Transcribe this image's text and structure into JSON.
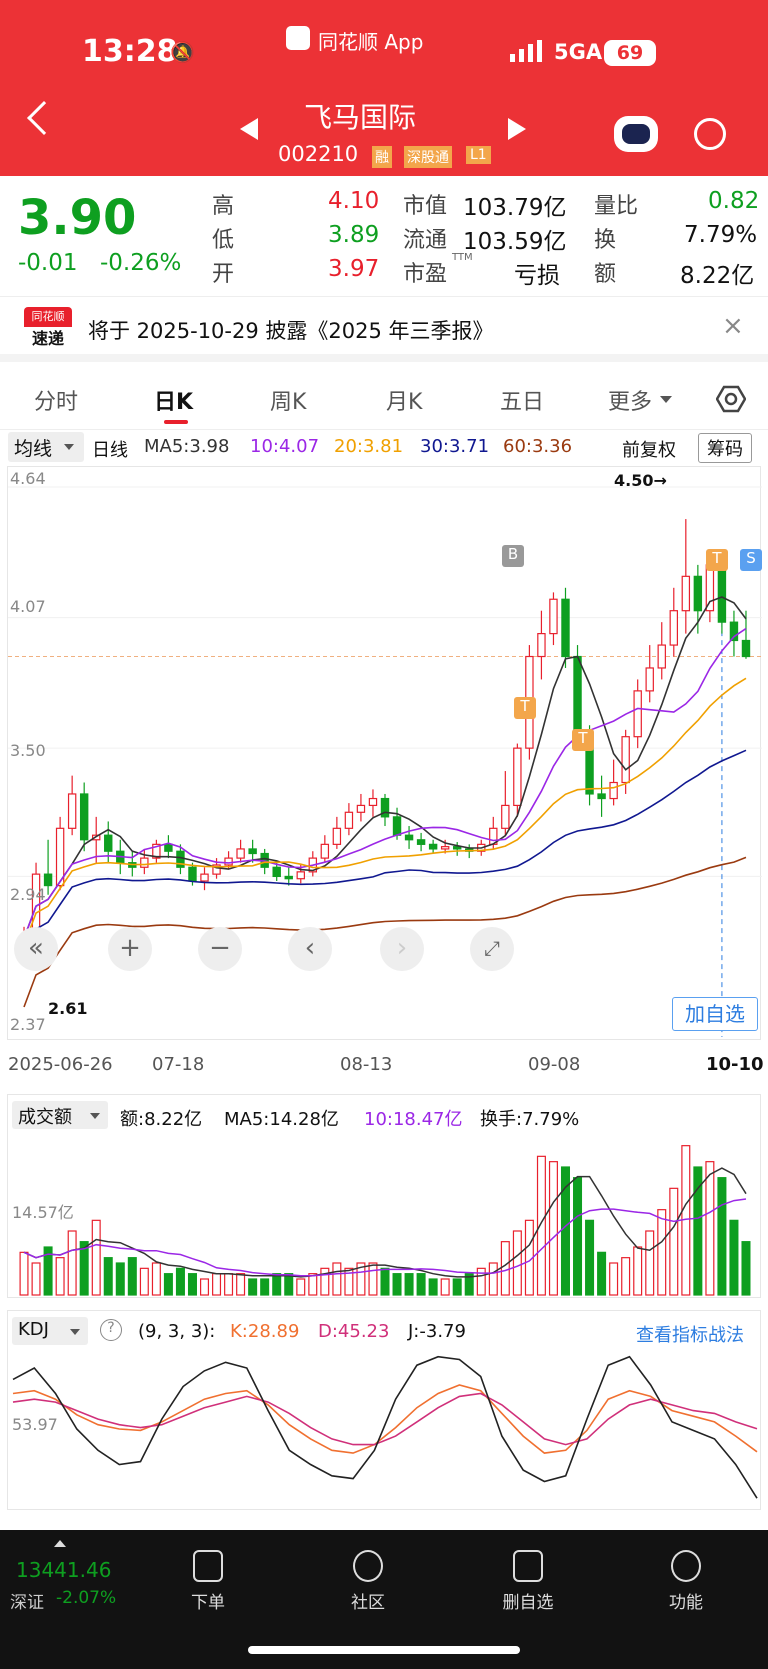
{
  "status_bar": {
    "time": "13:28",
    "app_name": "同花顺 App",
    "network": "5GA",
    "battery": "69"
  },
  "stock": {
    "name": "飞马国际",
    "code": "002210",
    "tags": [
      "融",
      "深股通",
      "L1"
    ]
  },
  "quote": {
    "price": "3.90",
    "change": "-0.01",
    "change_pct": "-0.26%",
    "high_label": "高",
    "high": "4.10",
    "low_label": "低",
    "low": "3.89",
    "open_label": "开",
    "open": "3.97",
    "mcap_label": "市值",
    "mcap": "103.79亿",
    "float_label": "流通",
    "float": "103.59亿",
    "pe_label": "市盈",
    "pe_sup": "TTM",
    "pe": "亏损",
    "vr_label": "量比",
    "vr": "0.82",
    "turn_label": "换",
    "turn": "7.79%",
    "amt_label": "额",
    "amt": "8.22亿"
  },
  "notice": {
    "logo_top": "同花顺",
    "logo_bottom": "速递",
    "text": "将于 2025-10-29 披露《2025 年三季报》"
  },
  "tabs": [
    "分时",
    "日K",
    "周K",
    "月K",
    "五日",
    "更多"
  ],
  "ma_line": {
    "selector": "均线",
    "period": "日线",
    "ma5": "MA5:3.98",
    "ma10": "10:4.07",
    "ma20": "20:3.81",
    "ma30": "30:3.71",
    "ma60": "60:3.36",
    "adjust": "前复权",
    "chips": "筹码"
  },
  "kline": {
    "y_labels": [
      "4.64",
      "4.07",
      "3.50",
      "2.94",
      "2.37"
    ],
    "max_marker": "4.50→",
    "min_marker": "2.61",
    "markers": [
      "B",
      "T",
      "T",
      "T",
      "S"
    ],
    "dates": [
      "2025-06-26",
      "07-18",
      "08-13",
      "09-08",
      "10-10"
    ],
    "add_watch": "加自选"
  },
  "volume": {
    "selector": "成交额",
    "amt": "额:8.22亿",
    "ma5": "MA5:14.28亿",
    "ma10": "10:18.47亿",
    "turnover": "换手:7.79%",
    "y_label": "14.57亿"
  },
  "kdj": {
    "selector": "KDJ",
    "params": "(9, 3, 3):",
    "k": "K:28.89",
    "d": "D:45.23",
    "j": "J:-3.79",
    "link": "查看指标战法",
    "y_label": "53.97"
  },
  "index_bar": {
    "value": "13441.46",
    "name": "深证",
    "change": "-2.07%"
  },
  "nav": [
    "下单",
    "社区",
    "删自选",
    "功能"
  ],
  "colors": {
    "header_bg": "#ec3236",
    "up": "#e8202c",
    "down": "#0e9f20",
    "ma10": "#9b27e6",
    "ma20": "#f0a000",
    "ma30": "#101890",
    "ma60": "#9a3a10"
  },
  "chart_data": [
    {
      "type": "candlestick",
      "title": "日K",
      "x_range": [
        "2025-06-26",
        "10-10"
      ],
      "ylim": [
        2.37,
        4.64
      ],
      "candles": [
        [
          2.61,
          2.67,
          2.58,
          2.72
        ],
        [
          2.67,
          2.95,
          2.65,
          3.0
        ],
        [
          2.95,
          2.9,
          2.86,
          3.1
        ],
        [
          2.9,
          3.15,
          2.88,
          3.2
        ],
        [
          3.15,
          3.3,
          3.12,
          3.38
        ],
        [
          3.3,
          3.1,
          3.05,
          3.35
        ],
        [
          3.1,
          3.12,
          3.0,
          3.2
        ],
        [
          3.12,
          3.05,
          3.0,
          3.18
        ],
        [
          3.05,
          3.0,
          2.95,
          3.1
        ],
        [
          3.0,
          2.98,
          2.94,
          3.05
        ],
        [
          2.98,
          3.02,
          2.95,
          3.06
        ],
        [
          3.02,
          3.08,
          3.0,
          3.1
        ],
        [
          3.08,
          3.05,
          3.02,
          3.12
        ],
        [
          3.05,
          2.98,
          2.95,
          3.08
        ],
        [
          2.98,
          2.92,
          2.9,
          3.0
        ],
        [
          2.92,
          2.95,
          2.88,
          2.98
        ],
        [
          2.95,
          2.99,
          2.93,
          3.02
        ],
        [
          2.99,
          3.02,
          2.97,
          3.05
        ],
        [
          3.02,
          3.06,
          3.0,
          3.1
        ],
        [
          3.06,
          3.04,
          3.0,
          3.1
        ],
        [
          3.04,
          2.98,
          2.95,
          3.06
        ],
        [
          2.98,
          2.94,
          2.92,
          3.0
        ],
        [
          2.94,
          2.93,
          2.9,
          2.98
        ],
        [
          2.93,
          2.96,
          2.91,
          2.99
        ],
        [
          2.96,
          3.02,
          2.94,
          3.05
        ],
        [
          3.02,
          3.08,
          3.0,
          3.12
        ],
        [
          3.08,
          3.15,
          3.06,
          3.2
        ],
        [
          3.15,
          3.22,
          3.12,
          3.26
        ],
        [
          3.22,
          3.25,
          3.18,
          3.3
        ],
        [
          3.25,
          3.28,
          3.2,
          3.32
        ],
        [
          3.28,
          3.2,
          3.16,
          3.3
        ],
        [
          3.2,
          3.12,
          3.1,
          3.24
        ],
        [
          3.12,
          3.1,
          3.06,
          3.16
        ],
        [
          3.1,
          3.08,
          3.05,
          3.13
        ],
        [
          3.08,
          3.06,
          3.04,
          3.1
        ],
        [
          3.06,
          3.07,
          3.04,
          3.1
        ],
        [
          3.07,
          3.06,
          3.03,
          3.09
        ],
        [
          3.06,
          3.05,
          3.02,
          3.08
        ],
        [
          3.05,
          3.08,
          3.03,
          3.1
        ],
        [
          3.08,
          3.15,
          3.06,
          3.2
        ],
        [
          3.15,
          3.25,
          3.12,
          3.4
        ],
        [
          3.25,
          3.5,
          3.2,
          3.52
        ],
        [
          3.5,
          3.9,
          3.45,
          3.95
        ],
        [
          3.9,
          4.0,
          3.8,
          4.1
        ],
        [
          4.0,
          4.15,
          3.95,
          4.18
        ],
        [
          4.15,
          3.9,
          3.85,
          4.2
        ],
        [
          3.9,
          3.55,
          3.5,
          3.95
        ],
        [
          3.55,
          3.3,
          3.25,
          3.6
        ],
        [
          3.3,
          3.28,
          3.2,
          3.38
        ],
        [
          3.28,
          3.35,
          3.25,
          3.45
        ],
        [
          3.35,
          3.55,
          3.3,
          3.58
        ],
        [
          3.55,
          3.75,
          3.5,
          3.8
        ],
        [
          3.75,
          3.85,
          3.7,
          3.95
        ],
        [
          3.85,
          3.95,
          3.8,
          4.05
        ],
        [
          3.95,
          4.1,
          3.9,
          4.2
        ],
        [
          4.1,
          4.25,
          4.0,
          4.5
        ],
        [
          4.25,
          4.1,
          4.0,
          4.3
        ],
        [
          4.1,
          4.3,
          4.05,
          4.35
        ],
        [
          4.3,
          4.05,
          4.0,
          4.35
        ],
        [
          4.05,
          3.97,
          3.9,
          4.1
        ],
        [
          3.97,
          3.9,
          3.89,
          4.1
        ]
      ]
    },
    {
      "type": "bar",
      "title": "成交额",
      "ylim": [
        0,
        30
      ],
      "values": [
        8,
        6,
        9,
        7,
        12,
        10,
        14,
        7,
        6,
        7,
        5,
        6,
        4,
        5,
        4,
        3,
        4,
        4,
        4,
        3,
        3,
        4,
        4,
        3,
        4,
        5,
        6,
        5,
        6,
        6,
        5,
        4,
        4,
        4,
        3,
        3,
        3,
        4,
        5,
        6,
        10,
        12,
        14,
        26,
        25,
        24,
        22,
        14,
        8,
        6,
        7,
        9,
        12,
        16,
        20,
        28,
        24,
        25,
        22,
        14,
        10
      ]
    },
    {
      "type": "line",
      "title": "KDJ",
      "ylim": [
        0,
        100
      ],
      "series": [
        {
          "name": "K",
          "values": [
            70,
            72,
            66,
            55,
            48,
            45,
            44,
            50,
            58,
            66,
            70,
            72,
            62,
            48,
            38,
            30,
            28,
            34,
            46,
            60,
            70,
            76,
            72,
            56,
            40,
            28,
            30,
            44,
            66,
            72,
            68,
            58,
            54,
            50,
            40,
            28.89
          ]
        },
        {
          "name": "D",
          "values": [
            64,
            66,
            64,
            58,
            52,
            48,
            46,
            48,
            54,
            60,
            64,
            68,
            64,
            56,
            46,
            38,
            34,
            34,
            40,
            50,
            60,
            68,
            70,
            62,
            50,
            38,
            34,
            38,
            52,
            62,
            66,
            62,
            58,
            56,
            50,
            45.23
          ]
        },
        {
          "name": "J",
          "values": [
            80,
            88,
            70,
            45,
            30,
            20,
            22,
            52,
            75,
            86,
            92,
            88,
            58,
            30,
            20,
            12,
            10,
            30,
            66,
            90,
            96,
            94,
            82,
            40,
            16,
            8,
            12,
            52,
            90,
            96,
            76,
            50,
            44,
            38,
            20,
            -3.79
          ]
        }
      ]
    }
  ]
}
